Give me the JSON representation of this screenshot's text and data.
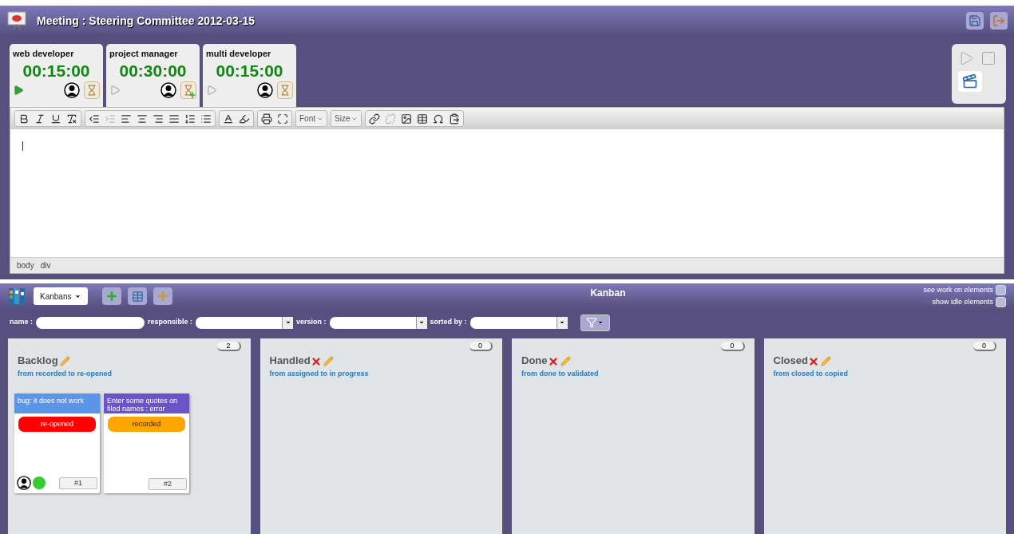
{
  "window": {
    "title": "Meeting : Steering Committee 2012-03-15"
  },
  "timers": [
    {
      "role": "web developer",
      "time": "00:15:00",
      "running": true,
      "kind": "plain"
    },
    {
      "role": "project manager",
      "time": "00:30:00",
      "running": false,
      "kind": "add"
    },
    {
      "role": "multi developer",
      "time": "00:15:00",
      "running": false,
      "kind": "plain"
    }
  ],
  "editor": {
    "toolbar_dropdowns": [
      "Font",
      "Size"
    ],
    "path": [
      "body",
      "div"
    ]
  },
  "kanban": {
    "menu": "Kanbans",
    "title": "Kanban",
    "options": [
      {
        "label": "see work on elements",
        "checked": false
      },
      {
        "label": "show idle elements",
        "checked": false
      }
    ],
    "filters": [
      {
        "label": "name :",
        "kind": "text"
      },
      {
        "label": "responsible :",
        "kind": "select"
      },
      {
        "label": "version :",
        "kind": "select"
      },
      {
        "label": "sorted by :",
        "kind": "select"
      }
    ],
    "columns": [
      {
        "title": "Backlog",
        "subtitle": "from recorded to re-opened",
        "count": "2",
        "deletable": false,
        "cards": [
          {
            "title": "bug: it does not work",
            "color": "#5b95e8",
            "status": {
              "label": "re-opened",
              "color": "#ff0000"
            },
            "number": "#1",
            "assigned": true,
            "dot": {
              "color": "#33cc33"
            }
          },
          {
            "title": "Enter some quotes on filed names : error",
            "color": "#6a55c8",
            "status": {
              "label": "recorded",
              "color": "#ffa500"
            },
            "number": "#2",
            "assigned": false
          }
        ]
      },
      {
        "title": "Handled",
        "subtitle": "from assigned to in progress",
        "count": "0",
        "deletable": true
      },
      {
        "title": "Done",
        "subtitle": "from done to validated",
        "count": "0",
        "deletable": true
      },
      {
        "title": "Closed",
        "subtitle": "from closed to copied",
        "count": "0",
        "deletable": true
      }
    ]
  }
}
